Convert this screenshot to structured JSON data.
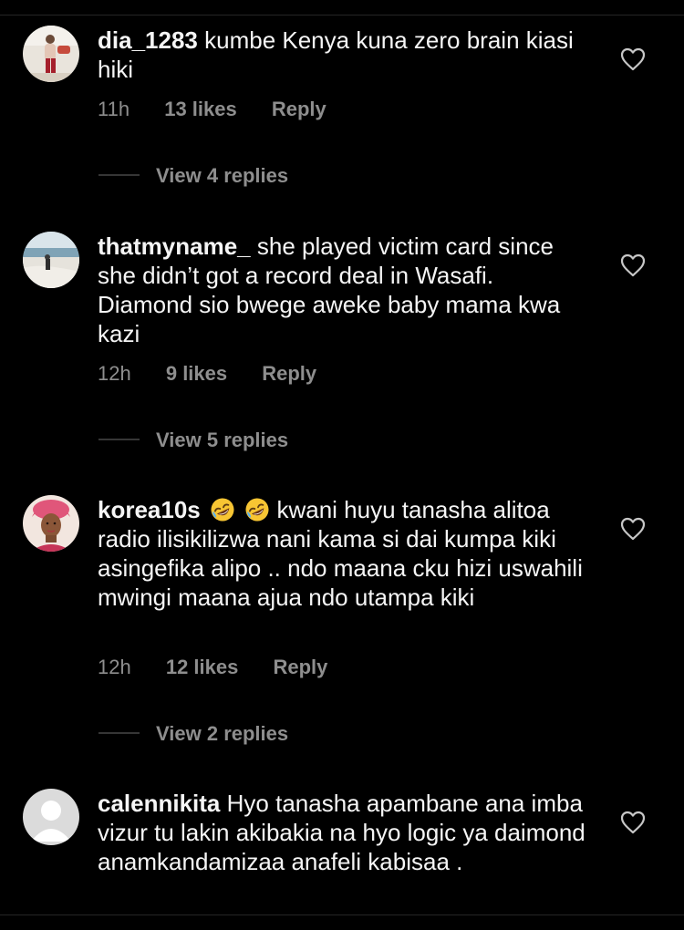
{
  "colors": {
    "background": "#000000",
    "text": "#f5f5f5",
    "secondary": "#8e8e8e",
    "divider": "#262626"
  },
  "comments": [
    {
      "username": "dia_1283",
      "text": "kumbe Kenya kuna zero brain kiasi hiki",
      "time": "11h",
      "likes": "13 likes",
      "reply": "Reply",
      "view_replies": "View 4 replies",
      "avatar": "avatar-photo-person-standing"
    },
    {
      "username": "thatmyname_",
      "text": "she played victim card since she didn’t got a record deal in Wasafi. Diamond sio bwege aweke baby mama kwa kazi",
      "time": "12h",
      "likes": "9 likes",
      "reply": "Reply",
      "view_replies": "View 5 replies",
      "avatar": "avatar-photo-beach"
    },
    {
      "username": "korea10s",
      "emojis": [
        "rolling-on-floor-laughing-emoji",
        "rolling-on-floor-laughing-emoji"
      ],
      "text": "kwani huyu tanasha alitoa radio ilisikilizwa nani kama si dai kumpa kiki asingefika alipo .. ndo maana cku hizi uswahili mwingi maana ajua ndo utampa kiki",
      "time": "12h",
      "likes": "12 likes",
      "reply": "Reply",
      "view_replies": "View 2 replies",
      "avatar": "avatar-photo-woman-headwrap"
    },
    {
      "username": "calennikita",
      "text": "Hyo tanasha apambane ana imba vizur tu lakin akibakia na hyo logic ya daimond anamkandamizaa anafeli kabisaa .",
      "avatar": "avatar-default-silhouette"
    }
  ],
  "icons": {
    "like": "heart-outline-icon"
  }
}
